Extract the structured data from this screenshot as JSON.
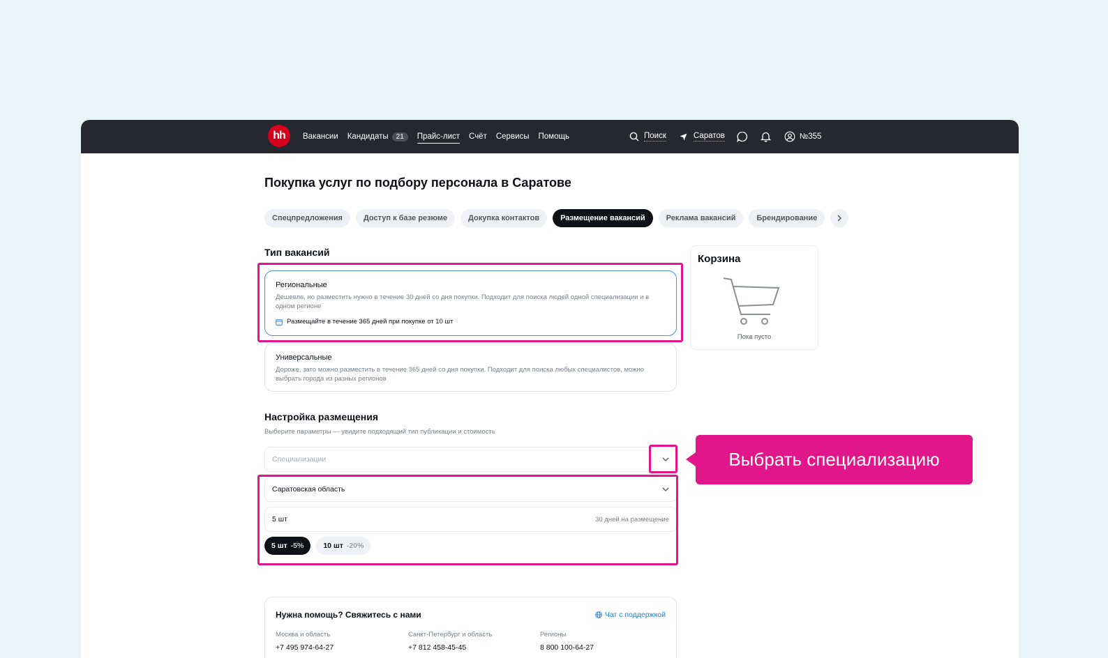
{
  "topbar": {
    "logo": "hh",
    "nav": [
      {
        "label": "Вакансии"
      },
      {
        "label": "Кандидаты",
        "badge": "21"
      },
      {
        "label": "Прайс-лист",
        "active": true
      },
      {
        "label": "Счёт"
      },
      {
        "label": "Сервисы"
      },
      {
        "label": "Помощь"
      }
    ],
    "search_label": "Поиск",
    "city_label": "Саратов",
    "account_label": "№355"
  },
  "page": {
    "title": "Покупка услуг по подбору персонала в Саратове",
    "tabs": [
      {
        "label": "Спецпредложения"
      },
      {
        "label": "Доступ к базе резюме"
      },
      {
        "label": "Докупка контактов"
      },
      {
        "label": "Размещение вакансий",
        "active": true
      },
      {
        "label": "Реклама вакансий"
      },
      {
        "label": "Брендирование"
      }
    ]
  },
  "vacancy_type": {
    "title": "Тип вакансий",
    "regional": {
      "title": "Региональные",
      "desc": "Дешевле, но разместить нужно в течение 30 дней со дня покупки. Подходит для поиска людей одной специализации и в одном регионе",
      "note": "Размещайте в течение 365 дней при покупке от 10 шт"
    },
    "universal": {
      "title": "Универсальные",
      "desc": "Дороже, зато можно разместить в течение 365 дней со дня покупки. Подходит для поиска любых специалистов, можно выбрать города из разных регионов"
    }
  },
  "cart": {
    "title": "Корзина",
    "empty_text": "Пока пусто"
  },
  "settings": {
    "title": "Настройка размещения",
    "subtitle": "Выберите параметры — увидите подходящий тип публикации и стоимость",
    "specialization_placeholder": "Специализации",
    "region_value": "Саратовская область",
    "quantity_value": "5 шт",
    "quantity_hint": "30 дней на размещение",
    "chips": [
      {
        "label": "5 шт",
        "discount": "-5%",
        "active": true
      },
      {
        "label": "10 шт",
        "discount": "-20%"
      }
    ]
  },
  "help": {
    "title": "Нужна помощь? Свяжитесь с нами",
    "chat_label": "Чат с поддержкой",
    "contacts": [
      {
        "label": "Москва и область",
        "phone": "+7 495 974-64-27"
      },
      {
        "label": "Санкт-Петербург и область",
        "phone": "+7 812 458-45-45"
      },
      {
        "label": "Регионы",
        "phone": "8 800 100-64-27"
      }
    ]
  },
  "annotation": {
    "callout_text": "Выбрать специализацию",
    "color": "#e0168a"
  }
}
